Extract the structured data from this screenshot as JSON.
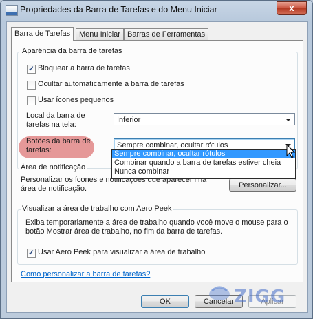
{
  "window": {
    "title": "Propriedades da Barra de Tarefas e do Menu Iniciar",
    "close_label": "x"
  },
  "tabs": [
    {
      "label": "Barra de Tarefas",
      "active": true
    },
    {
      "label": "Menu Iniciar",
      "active": false
    },
    {
      "label": "Barras de Ferramentas",
      "active": false
    }
  ],
  "appearance": {
    "group_title": "Aparência da barra de tarefas",
    "checkboxes": [
      {
        "label": "Bloquear a barra de tarefas",
        "checked": true
      },
      {
        "label": "Ocultar automaticamente a barra de tarefas",
        "checked": false
      },
      {
        "label": "Usar ícones pequenos",
        "checked": false
      }
    ],
    "location_label_line1": "Local da barra de",
    "location_label_line2": "tarefas na tela:",
    "location_value": "Inferior",
    "buttons_label_line1": "Botões da barra de",
    "buttons_label_line2": "tarefas:",
    "buttons_value": "Sempre combinar, ocultar rótulos",
    "buttons_options": [
      "Sempre combinar, ocultar rótulos",
      "Combinar quando a barra de tarefas estiver cheia",
      "Nunca combinar"
    ]
  },
  "notification": {
    "group_title": "Área de notificação",
    "text_line1": "Personalizar os ícones e notificações que aparecem na",
    "text_line2": "área de notificação.",
    "customize_button": "Personalizar..."
  },
  "aero_peek": {
    "group_title": "Visualizar a área de trabalho com Aero Peek",
    "text_line1": "Exiba temporariamente a área de trabalho quando você move o mouse para o",
    "text_line2": "botão Mostrar área de trabalho, no fim da barra de tarefas.",
    "checkbox_label": "Usar Aero Peek para visualizar a área de trabalho",
    "checked": true
  },
  "help_link": "Como personalizar a barra de tarefas?",
  "footer": {
    "ok": "OK",
    "cancel": "Cancelar",
    "apply": "Aplicar"
  },
  "watermark_text": "ZIGG",
  "check_mark": "✓",
  "colors": {
    "selection": "#3399ff",
    "highlight_oval": "#e08686",
    "link": "#0066cc"
  }
}
